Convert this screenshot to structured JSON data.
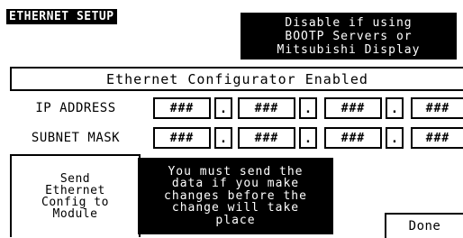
{
  "screen_title": "ETHERNET SETUP",
  "note_lines": [
    "Disable if using",
    "BOOTP Servers or",
    "Mitsubishi Display"
  ],
  "banner": "Ethernet Configurator Enabled",
  "rows": [
    {
      "label": "IP ADDRESS",
      "octets": [
        "###",
        "###",
        "###",
        "###"
      ]
    },
    {
      "label": "SUBNET MASK",
      "octets": [
        "###",
        "###",
        "###",
        "###"
      ]
    }
  ],
  "separator": ".",
  "send_button_lines": [
    "Send",
    "Ethernet",
    "Config to",
    "Module"
  ],
  "warning_lines": [
    "You must send the",
    "data if you make",
    "changes before the",
    "change will take",
    "place"
  ],
  "done_button": "Done"
}
